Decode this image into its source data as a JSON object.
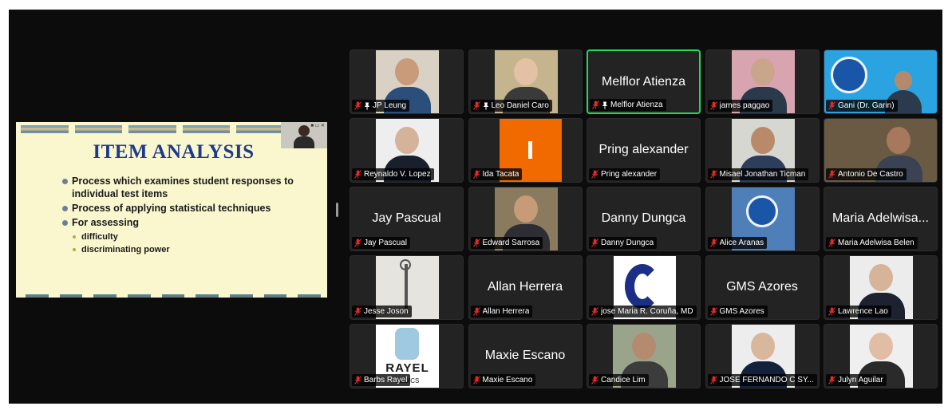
{
  "shared_screen": {
    "slide_title": "ITEM ANALYSIS",
    "bullets": [
      {
        "text": "Process which examines student responses to individual test items",
        "sub": []
      },
      {
        "text": "Process of applying statistical techniques",
        "sub": []
      },
      {
        "text": "For assessing",
        "sub": [
          "difficulty",
          "discriminating power"
        ]
      }
    ]
  },
  "participants": [
    {
      "name": "JP Leung",
      "pinned": true
    },
    {
      "name": "Leo Daniel Caro",
      "pinned": true
    },
    {
      "name": "Melflor Atienza",
      "display": "Melflor Atienza",
      "pinned": true
    },
    {
      "name": "james paggao",
      "pinned": false
    },
    {
      "name": "Gani (Dr. Garin)",
      "pinned": false
    },
    {
      "name": "Reynaldo V. Lopez",
      "pinned": false
    },
    {
      "name": "Ida Tacata",
      "pinned": false
    },
    {
      "name": "Pring alexander",
      "display": "Pring alexander",
      "pinned": false
    },
    {
      "name": "Misael Jonathan Ticman",
      "pinned": false
    },
    {
      "name": "Antonio De Castro",
      "pinned": false
    },
    {
      "name": "Jay Pascual",
      "display": "Jay Pascual",
      "pinned": false
    },
    {
      "name": "Edward Sarrosa",
      "pinned": false
    },
    {
      "name": "Danny Dungca",
      "display": "Danny Dungca",
      "pinned": false
    },
    {
      "name": "Alice Aranas",
      "pinned": false
    },
    {
      "name": "Maria Adelwisa Belen",
      "display": "Maria Adelwisa...",
      "pinned": false
    },
    {
      "name": "Jesse Joson",
      "pinned": false
    },
    {
      "name": "Allan Herrera",
      "display": "Allan Herrera",
      "pinned": false
    },
    {
      "name": "jose Maria R. Coruña, MD",
      "pinned": false
    },
    {
      "name": "GMS Azores",
      "display": "GMS Azores",
      "pinned": false
    },
    {
      "name": "Lawrence Lao",
      "pinned": false
    },
    {
      "name": "Barbs Rayel",
      "pinned": false
    },
    {
      "name": "Maxie Escano",
      "display": "Maxie Escano",
      "pinned": false
    },
    {
      "name": "Candice Lim",
      "pinned": false
    },
    {
      "name": "JOSE FERNANDO C SY...",
      "pinned": false
    },
    {
      "name": "Julyn Aguilar",
      "pinned": false
    }
  ],
  "tile_logos": {
    "rayel_word": "RAYEL",
    "rayel_sub": "AEDICS"
  },
  "colors": {
    "active_speaker": "#23d959",
    "muted_mic": "#e02b2b",
    "slide_title": "#1f3a8a"
  },
  "icons": {
    "muted": "mic-muted-icon",
    "pinned": "pin-icon"
  }
}
